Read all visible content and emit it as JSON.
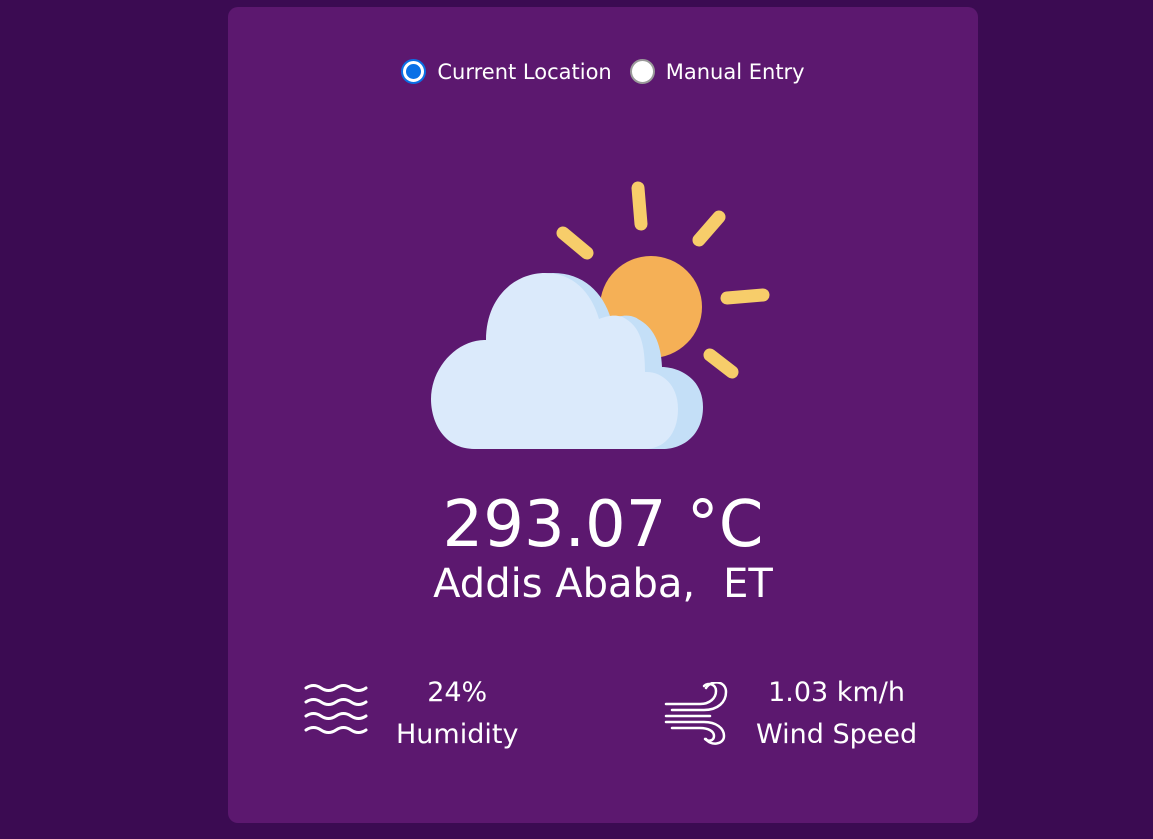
{
  "location_mode": {
    "options": [
      {
        "label": "Current Location",
        "checked": true
      },
      {
        "label": "Manual Entry",
        "checked": false
      }
    ]
  },
  "weather": {
    "icon": "partly-cloudy-icon",
    "temperature": "293.07 °C",
    "city": "Addis Ababa,",
    "country": "ET"
  },
  "stats": {
    "humidity": {
      "icon": "humidity-waves-icon",
      "value": "24%",
      "label": "Humidity"
    },
    "wind": {
      "icon": "wind-icon",
      "value": "1.03 km/h",
      "label": "Wind Speed"
    }
  },
  "colors": {
    "background": "#3b0b52",
    "card": "#5c186f",
    "radio_accent": "#0a70e6",
    "sun": "#f5b056",
    "sun_rays": "#f7cd6a",
    "cloud": "#dbeafb"
  }
}
